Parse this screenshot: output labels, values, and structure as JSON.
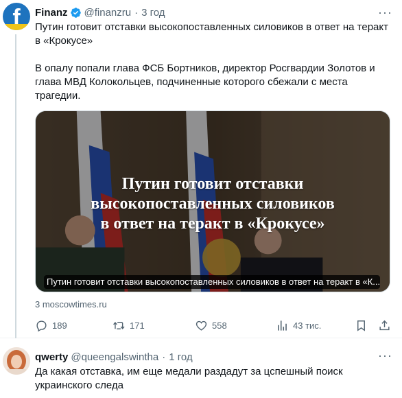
{
  "tweet": {
    "author_name": "Finanz",
    "handle": "@finanzru",
    "separator": "·",
    "time": "3 год",
    "more": "···",
    "text_line1": "Путин готовит отставки высокопоставленных силовиков в ответ на теракт в «Крокусе»",
    "text_line2": "В опалу попали глава ФСБ Бортников, директор Росгвардии Золотов и глава МВД Колокольцев, подчиненные которого сбежали с места трагедии.",
    "card": {
      "headline_1": "Путин готовит отставки",
      "headline_2": "высокопоставленных силовиков",
      "headline_3": "в ответ на теракт в «Крокусе»",
      "caption": "Путин готовит отставки высокопоставленных силовиков в ответ на теракт в «К..."
    },
    "domain": "3 moscowtimes.ru",
    "actions": {
      "replies": "189",
      "retweets": "171",
      "likes": "558",
      "views": "43 тис."
    },
    "colors": {
      "verified": "#1d9bf0",
      "muted": "#536471",
      "avatar_bg": "#1e73be"
    },
    "icons": [
      "verified-badge-icon",
      "reply-icon",
      "retweet-icon",
      "like-icon",
      "views-icon",
      "bookmark-icon",
      "share-icon"
    ]
  },
  "reply": {
    "author_name": "qwerty",
    "handle": "@queengalswintha",
    "separator": "·",
    "time": "1 год",
    "more": "···",
    "text": "Да какая отставка, им еще медали раздадут за цспешный поиск украинского следа"
  }
}
